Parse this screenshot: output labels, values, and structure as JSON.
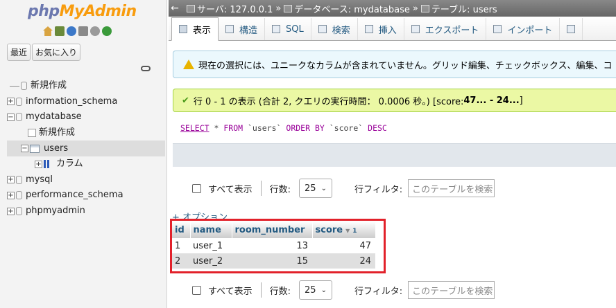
{
  "nav": {
    "logo_php": "php",
    "logo_my": "MyAdmin",
    "tab_recent": "最近",
    "tab_favorites": "お気に入り",
    "icons": [
      "home-icon",
      "logout-icon",
      "help-icon",
      "docs-icon",
      "settings-icon",
      "reload-icon"
    ],
    "tree": {
      "new": "新規作成",
      "db1": "information_schema",
      "db2": "mydatabase",
      "db2_new": "新規作成",
      "table": "users",
      "columns": "カラム",
      "db3": "mysql",
      "db4": "performance_schema",
      "db5": "phpmyadmin"
    }
  },
  "breadcrumb": {
    "server": "サーバ: 127.0.0.1",
    "database": "データベース: mydatabase",
    "table": "テーブル: users",
    "separator": "»"
  },
  "tabs": [
    "表示",
    "構造",
    "SQL",
    "検索",
    "挿入",
    "エクスポート",
    "インポート"
  ],
  "warning": "現在の選択には、ユニークなカラムが含まれていません。グリッド編集、チェックボックス、編集、コ",
  "success": {
    "text": "行 0 - 1 の表示 (合計 2, クエリの実行時間： 0.0006 秒。) [score: ",
    "bold": "47... - 24...",
    "suffix": "]"
  },
  "sql": {
    "select": "SELECT",
    "star": "*",
    "from": "FROM",
    "table": "`users`",
    "order": "ORDER BY",
    "col": "`score`",
    "desc": "DESC"
  },
  "controls": {
    "show_all": "すべて表示",
    "rows_label": "行数:",
    "rows_value": "25",
    "filter_label": "行フィルタ:",
    "filter_placeholder": "このテーブルを検索"
  },
  "options_link": "+ オプション",
  "table": {
    "headers": [
      "id",
      "name",
      "room_number",
      "score"
    ],
    "sort_index": "1",
    "rows": [
      {
        "id": "1",
        "name": "user_1",
        "room_number": "13",
        "score": "47"
      },
      {
        "id": "2",
        "name": "user_2",
        "room_number": "15",
        "score": "24"
      }
    ]
  },
  "colors": {
    "highlight": "#e2212a",
    "link": "#235a81",
    "warning_bg": "#ebf8fd",
    "success_bg": "#ebf8a4"
  }
}
